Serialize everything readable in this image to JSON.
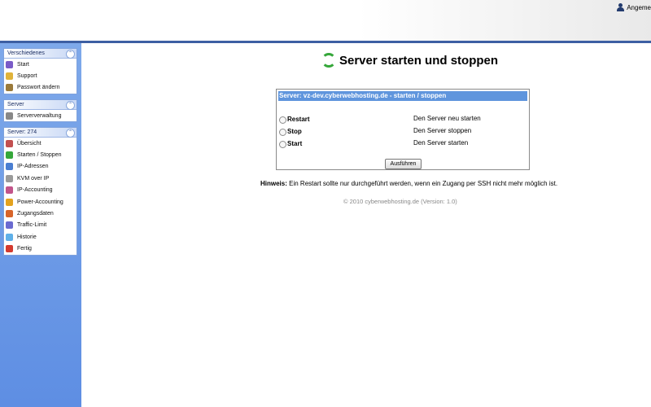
{
  "topbar": {
    "user_label": "Angeme"
  },
  "sidebar": {
    "panels": [
      {
        "title": "Verschiedenes",
        "items": [
          {
            "label": "Start",
            "icon": "people-icon",
            "color": "#7a5bc7"
          },
          {
            "label": "Support",
            "icon": "support-icon",
            "color": "#e0b33a"
          },
          {
            "label": "Passwort ändern",
            "icon": "lock-icon",
            "color": "#9a7a3a"
          }
        ]
      },
      {
        "title": "Server",
        "items": [
          {
            "label": "Serververwaltung",
            "icon": "server-icon",
            "color": "#888888"
          }
        ]
      },
      {
        "title": "Server: 274",
        "items": [
          {
            "label": "Übersicht",
            "icon": "overview-icon",
            "color": "#c25050"
          },
          {
            "label": "Starten / Stoppen",
            "icon": "refresh-icon",
            "color": "#35a73a"
          },
          {
            "label": "IP-Adressen",
            "icon": "ip-icon",
            "color": "#4a7ed1"
          },
          {
            "label": "KVM over IP",
            "icon": "kvm-icon",
            "color": "#9a9a9a"
          },
          {
            "label": "IP-Accounting",
            "icon": "chart-icon",
            "color": "#c2548a"
          },
          {
            "label": "Power-Accounting",
            "icon": "power-icon",
            "color": "#e3a21f"
          },
          {
            "label": "Zugangsdaten",
            "icon": "key-icon",
            "color": "#d8652a"
          },
          {
            "label": "Traffic-Limit",
            "icon": "traffic-icon",
            "color": "#6a6ad0"
          },
          {
            "label": "Historie",
            "icon": "history-icon",
            "color": "#5fb0e8"
          },
          {
            "label": "Fertig",
            "icon": "check-icon",
            "color": "#d33a2f"
          }
        ]
      }
    ]
  },
  "main": {
    "title": "Server starten und stoppen",
    "box": {
      "header": "Server: vz-dev.cyberwebhosting.de - starten / stoppen",
      "options": [
        {
          "label": "Restart",
          "desc": "Den Server neu starten"
        },
        {
          "label": "Stop",
          "desc": "Den Server stoppen"
        },
        {
          "label": "Start",
          "desc": "Den Server starten"
        }
      ],
      "button": "Ausführen"
    },
    "hint_label": "Hinweis:",
    "hint_text": " Ein Restart sollte nur durchgeführt werden, wenn ein Zugang per SSH nicht mehr möglich ist.",
    "footer": "© 2010 cyberwebhosting.de (Version: 1.0)"
  }
}
